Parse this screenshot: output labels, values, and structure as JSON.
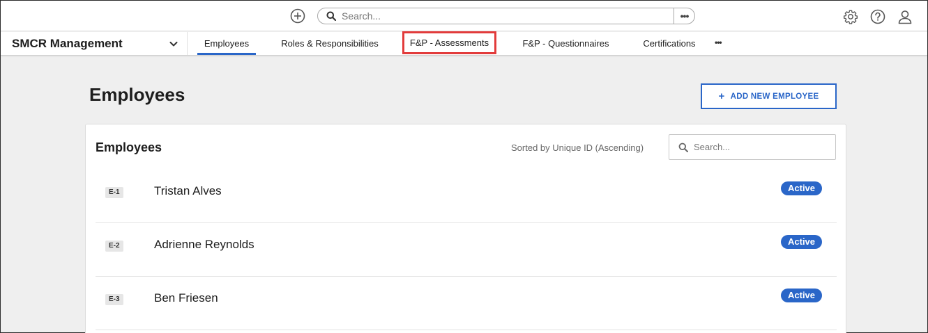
{
  "topbar": {
    "search_placeholder": "Search...",
    "more_label": "•••",
    "icons": [
      "add-circle-icon",
      "search-icon",
      "gear-icon",
      "help-icon",
      "user-icon"
    ]
  },
  "nav": {
    "app_name": "SMCR Management",
    "tabs": [
      {
        "label": "Employees",
        "active": true
      },
      {
        "label": "Roles & Responsibilities"
      },
      {
        "label": "F&P - Assessments",
        "highlighted": true
      },
      {
        "label": "F&P - Questionnaires"
      },
      {
        "label": "Certifications"
      }
    ],
    "more_label": "•••"
  },
  "page": {
    "title": "Employees",
    "add_button_label": "ADD NEW EMPLOYEE"
  },
  "card": {
    "title": "Employees",
    "sort_text": "Sorted by Unique ID (Ascending)",
    "search_placeholder": "Search...",
    "rows": [
      {
        "uid": "E-1",
        "name": "Tristan Alves",
        "status": "Active"
      },
      {
        "uid": "E-2",
        "name": "Adrienne Reynolds",
        "status": "Active"
      },
      {
        "uid": "E-3",
        "name": "Ben Friesen",
        "status": "Active"
      }
    ]
  },
  "colors": {
    "accent": "#2a66c8",
    "highlight": "#e23b3b",
    "background": "#efefef"
  }
}
